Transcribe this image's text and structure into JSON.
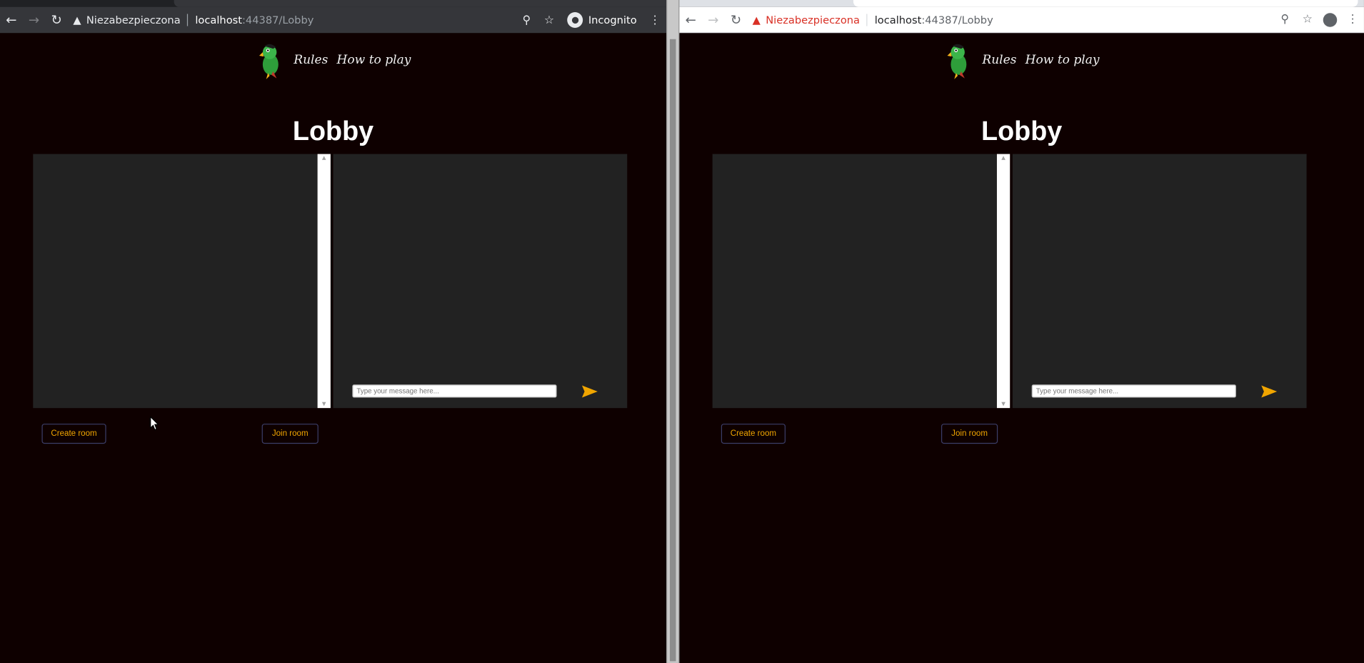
{
  "windows": [
    {
      "variant": "incognito",
      "security_label": "Niezabezpieczona",
      "url_host": "localhost",
      "url_path": ":44387/Lobby",
      "incognito_label": "Incognito",
      "site_nav": [
        "Rules",
        "How to play"
      ],
      "page_title": "Lobby",
      "chat_placeholder": "Type your message here...",
      "create_room_label": "Create room",
      "join_room_label": "Join room"
    },
    {
      "variant": "normal",
      "security_label": "Niezabezpieczona",
      "url_host": "localhost",
      "url_path": ":44387/Lobby",
      "site_nav": [
        "Rules",
        "How to play"
      ],
      "page_title": "Lobby",
      "chat_placeholder": "Type your message here...",
      "create_room_label": "Create room",
      "join_room_label": "Join room"
    }
  ],
  "colors": {
    "page_background": "#0e0000",
    "panel_background": "#222222",
    "accent_orange": "#f0a500",
    "button_border": "#3b3d68"
  },
  "icons": [
    "back-arrow-icon",
    "forward-arrow-icon",
    "reload-icon",
    "warning-icon",
    "zoom-icon",
    "star-icon",
    "incognito-icon",
    "profile-icon",
    "menu-dots-icon",
    "parrot-logo-icon",
    "send-icon",
    "mouse-cursor-icon"
  ]
}
